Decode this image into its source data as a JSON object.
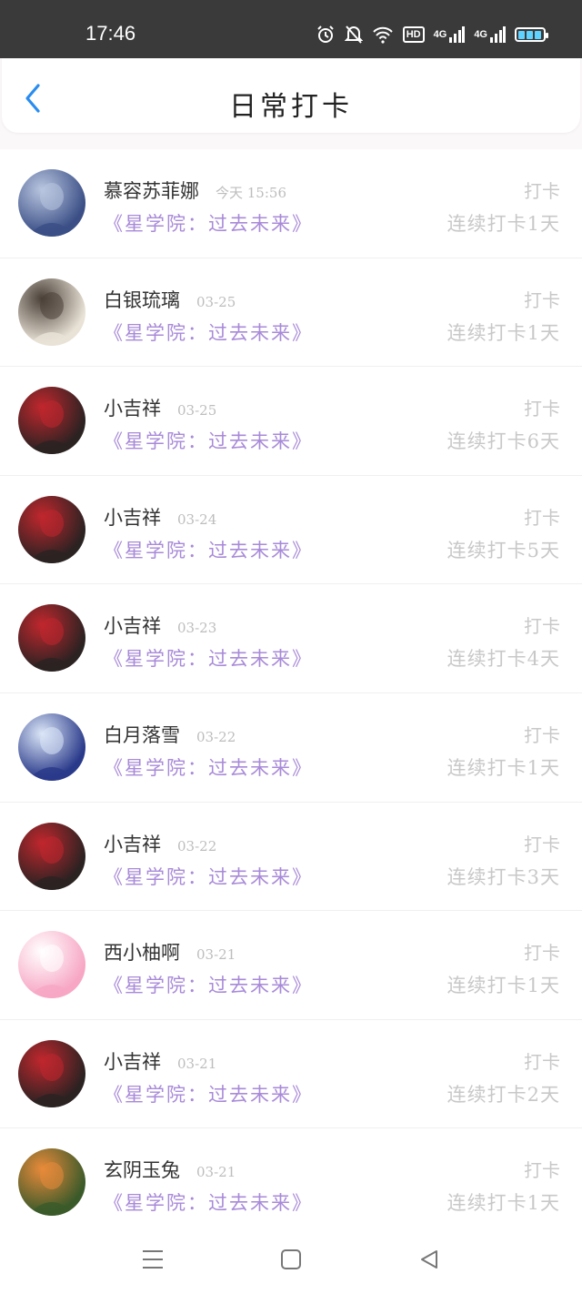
{
  "status_bar": {
    "time": "17:46",
    "hd_label": "HD",
    "net1_label": "4G",
    "net2_label": "4G"
  },
  "header": {
    "title": "日常打卡",
    "accent_color": "#2a8cf0"
  },
  "list": [
    {
      "name": "慕容苏菲娜",
      "time": "今天 15:56",
      "circle": "《星学院：过去未来》",
      "action": "打卡",
      "streak": "连续打卡1天",
      "avatar_colors": [
        "#3b4f86",
        "#b9c6e0"
      ]
    },
    {
      "name": "白银琉璃",
      "time": "03-25",
      "circle": "《星学院：过去未来》",
      "action": "打卡",
      "streak": "连续打卡1天",
      "avatar_colors": [
        "#e9e2d6",
        "#4a4038"
      ]
    },
    {
      "name": "小吉祥",
      "time": "03-25",
      "circle": "《星学院：过去未来》",
      "action": "打卡",
      "streak": "连续打卡6天",
      "avatar_colors": [
        "#2b2222",
        "#c0272d"
      ]
    },
    {
      "name": "小吉祥",
      "time": "03-24",
      "circle": "《星学院：过去未来》",
      "action": "打卡",
      "streak": "连续打卡5天",
      "avatar_colors": [
        "#2b2222",
        "#c0272d"
      ]
    },
    {
      "name": "小吉祥",
      "time": "03-23",
      "circle": "《星学院：过去未来》",
      "action": "打卡",
      "streak": "连续打卡4天",
      "avatar_colors": [
        "#2b2222",
        "#c0272d"
      ]
    },
    {
      "name": "白月落雪",
      "time": "03-22",
      "circle": "《星学院：过去未来》",
      "action": "打卡",
      "streak": "连续打卡1天",
      "avatar_colors": [
        "#2a3a8a",
        "#dbe6f7"
      ]
    },
    {
      "name": "小吉祥",
      "time": "03-22",
      "circle": "《星学院：过去未来》",
      "action": "打卡",
      "streak": "连续打卡3天",
      "avatar_colors": [
        "#2b2222",
        "#c0272d"
      ]
    },
    {
      "name": "西小柚啊",
      "time": "03-21",
      "circle": "《星学院：过去未来》",
      "action": "打卡",
      "streak": "连续打卡1天",
      "avatar_colors": [
        "#f7a7c4",
        "#ffffff"
      ]
    },
    {
      "name": "小吉祥",
      "time": "03-21",
      "circle": "《星学院：过去未来》",
      "action": "打卡",
      "streak": "连续打卡2天",
      "avatar_colors": [
        "#2b2222",
        "#c0272d"
      ]
    },
    {
      "name": "玄阴玉兔",
      "time": "03-21",
      "circle": "《星学院：过去未来》",
      "action": "打卡",
      "streak": "连续打卡1天",
      "avatar_colors": [
        "#3b5a2a",
        "#e88a3a"
      ]
    }
  ],
  "colors": {
    "status_bar_bg": "#3a3a3a",
    "circle_text": "#a88ad8",
    "muted_text": "#c8c8c8"
  }
}
